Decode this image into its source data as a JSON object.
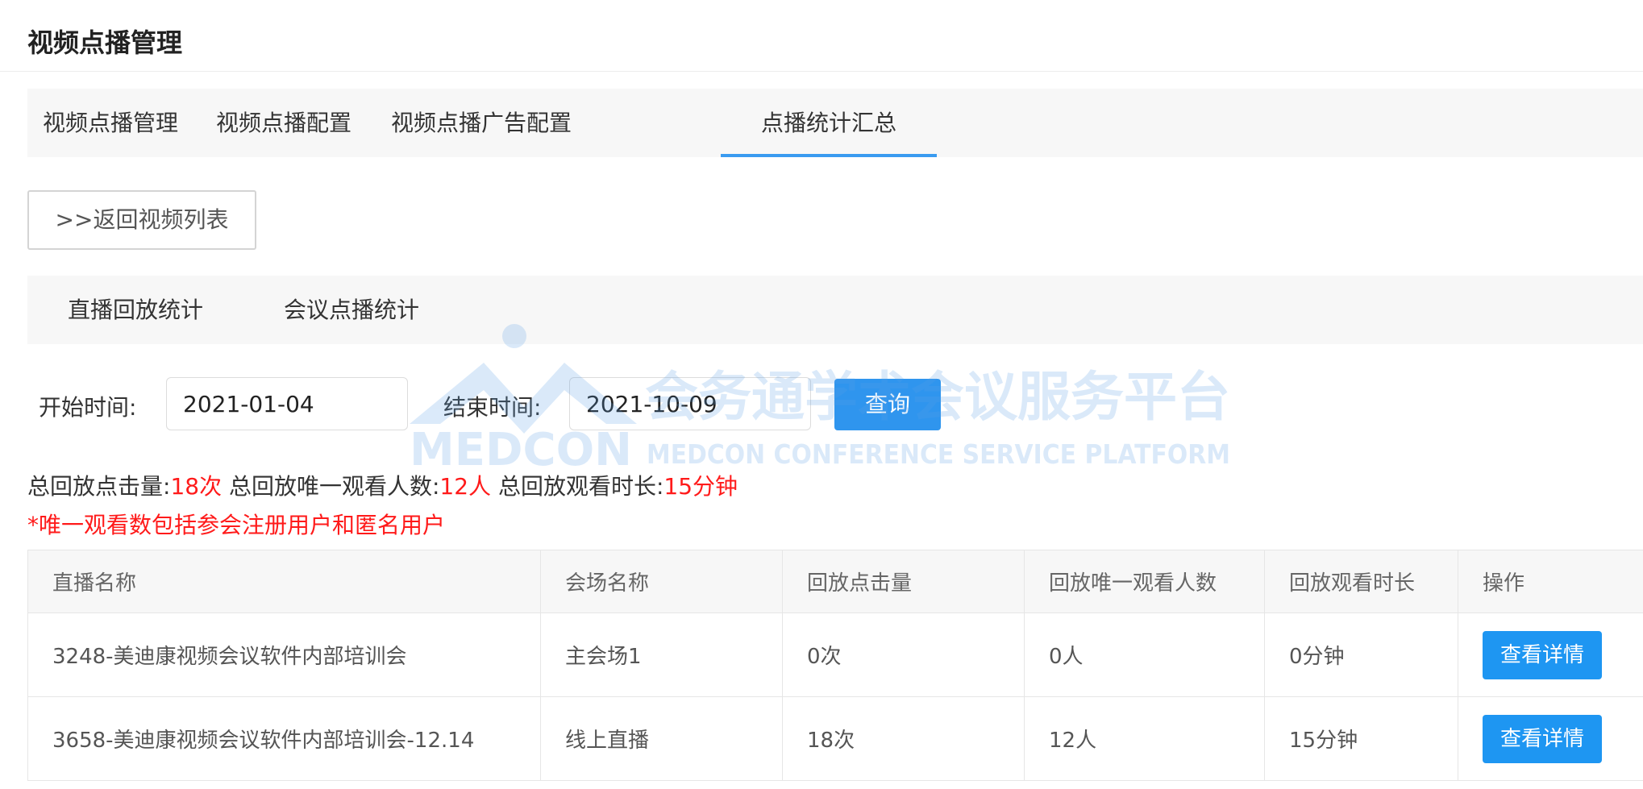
{
  "page": {
    "title": "视频点播管理"
  },
  "tabs": [
    {
      "label": "视频点播管理"
    },
    {
      "label": "视频点播配置"
    },
    {
      "label": "视频点播广告配置"
    },
    {
      "label": "点播统计汇总"
    }
  ],
  "active_tab": "点播统计汇总",
  "back_button": {
    "label": ">>返回视频列表"
  },
  "sub_tabs": [
    {
      "label": "直播回放统计"
    },
    {
      "label": "会议点播统计"
    }
  ],
  "filter": {
    "start_label": "开始时间:",
    "start_value": "2021-01-04",
    "end_label": "结束时间:",
    "end_value": "2021-10-09",
    "query_button": "查询"
  },
  "summary": {
    "clicks_label": "总回放点击量:",
    "clicks_value": "18次",
    "unique_label": "总回放唯一观看人数:",
    "unique_value": "12人",
    "duration_label": "总回放观看时长:",
    "duration_value": "15分钟"
  },
  "note": "*唯一观看数包括参会注册用户和匿名用户",
  "table": {
    "columns": [
      "直播名称",
      "会场名称",
      "回放点击量",
      "回放唯一观看人数",
      "回放观看时长",
      "操作"
    ],
    "rows": [
      {
        "name": "3248-美迪康视频会议软件内部培训会",
        "venue": "主会场1",
        "clicks": "0次",
        "unique": "0人",
        "duration": "0分钟",
        "action": "查看详情"
      },
      {
        "name": "3658-美迪康视频会议软件内部培训会-12.14",
        "venue": "线上直播",
        "clicks": "18次",
        "unique": "12人",
        "duration": "15分钟",
        "action": "查看详情"
      }
    ]
  },
  "watermark": {
    "logo_text": "MEDCON",
    "cn_text": "会务通学术会议服务平台",
    "en_text": "MEDCON CONFERENCE SERVICE PLATFORM"
  },
  "colors": {
    "accent": "#2f95ee",
    "highlight_red": "#ff1a1a",
    "tab_underline": "#3a9bf0"
  }
}
